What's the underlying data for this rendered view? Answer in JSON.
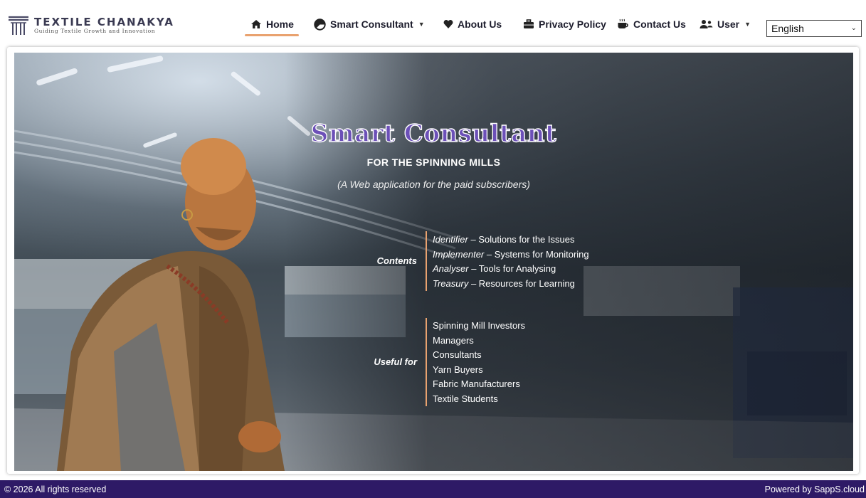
{
  "brand": {
    "name": "TEXTILE CHANAKYA",
    "tagline": "Guiding Textile Growth and Innovation"
  },
  "nav": {
    "items": [
      {
        "label": "Home",
        "icon": "home-icon",
        "active": true
      },
      {
        "label": "Smart Consultant",
        "icon": "pie-chart-icon",
        "dropdown": true
      },
      {
        "label": "About Us",
        "icon": "heart-icon"
      },
      {
        "label": "Privacy Policy",
        "icon": "briefcase-icon"
      },
      {
        "label": "Contact Us",
        "icon": "coffee-icon"
      },
      {
        "label": "User",
        "icon": "users-icon",
        "dropdown": true
      }
    ],
    "language": {
      "selected": "English"
    }
  },
  "hero": {
    "title": "Smart Consultant",
    "subtitle": "FOR THE SPINNING MILLS",
    "note": "(A Web application for the paid subscribers)",
    "contents": {
      "label": "Contents",
      "items": [
        {
          "name": "Identifier",
          "desc": " – Solutions for the Issues"
        },
        {
          "name": "Implementer",
          "desc": " – Systems for Monitoring"
        },
        {
          "name": "Analyser",
          "desc": " – Tools for Analysing"
        },
        {
          "name": "Treasury",
          "desc": " – Resources for Learning"
        }
      ]
    },
    "useful_for": {
      "label": "Useful for",
      "items": [
        "Spinning Mill Investors",
        "Managers",
        "Consultants",
        "Yarn Buyers",
        "Fabric Manufacturers",
        "Textile Students"
      ]
    }
  },
  "footer": {
    "copyright": "© 2026 All rights reserved",
    "powered_by": "Powered by SappS.cloud"
  },
  "colors": {
    "accent": "#e9a26f",
    "title_purple": "#6c50b8",
    "footer_bg": "#2e1a66"
  }
}
